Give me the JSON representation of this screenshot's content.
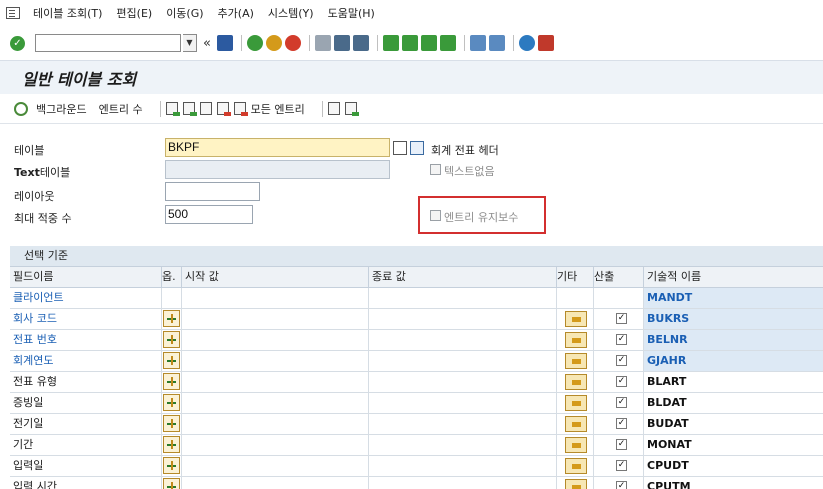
{
  "menubar": {
    "items": [
      "테이블 조회(T)",
      "편집(E)",
      "이동(G)",
      "추가(A)",
      "시스템(Y)",
      "도움말(H)"
    ]
  },
  "toolbar": {
    "command_value": "",
    "nav_symbol": "«",
    "icons": [
      "save-icon",
      "back-icon",
      "exit-icon",
      "cancel-icon",
      "print-icon",
      "find-icon",
      "find-next-icon",
      "first-page-icon",
      "prev-page-icon",
      "next-page-icon",
      "last-page-icon",
      "new-session-icon",
      "shortcut-icon",
      "help-icon",
      "layout-icon"
    ],
    "colors": {
      "ok": "#3a9a3a",
      "exit": "#d49a1a",
      "cancel": "#d23b2b"
    }
  },
  "title": "일반 테이블 조회",
  "app_toolbar": {
    "background_label": "백그라운드",
    "entries_label": "엔트리 수",
    "all_entries_label": "모든 엔트리"
  },
  "form": {
    "table_label": "테이블",
    "table_value": "BKPF",
    "table_desc": "회계 전표 헤더",
    "text_table_label_bold": "Text",
    "text_table_label_rest": "테이블",
    "no_text_label": "텍스트없음",
    "layout_label": "레이아웃",
    "layout_value": "",
    "max_hits_label": "최대 적중 수",
    "max_hits_value": "500",
    "maintain_entries_label": "엔트리 유지보수"
  },
  "table": {
    "section_title": "선택 기준",
    "headers": {
      "name": "필드이름",
      "opt": "옵.",
      "from": "시작 값",
      "to": "종료 값",
      "more": "기타",
      "output": "산출",
      "tech": "기술적 이름"
    },
    "rows": [
      {
        "name": "클라이언트",
        "key": true,
        "opt": false,
        "checked": false,
        "tech": "MANDT"
      },
      {
        "name": "회사 코드",
        "key": true,
        "opt": true,
        "checked": true,
        "tech": "BUKRS"
      },
      {
        "name": "전표 번호",
        "key": true,
        "opt": true,
        "checked": true,
        "tech": "BELNR"
      },
      {
        "name": "회계연도",
        "key": true,
        "opt": true,
        "checked": true,
        "tech": "GJAHR"
      },
      {
        "name": "전표 유형",
        "key": false,
        "opt": true,
        "checked": true,
        "tech": "BLART"
      },
      {
        "name": "증빙일",
        "key": false,
        "opt": true,
        "checked": true,
        "tech": "BLDAT"
      },
      {
        "name": "전기일",
        "key": false,
        "opt": true,
        "checked": true,
        "tech": "BUDAT"
      },
      {
        "name": "기간",
        "key": false,
        "opt": true,
        "checked": true,
        "tech": "MONAT"
      },
      {
        "name": "입력일",
        "key": false,
        "opt": true,
        "checked": true,
        "tech": "CPUDT"
      },
      {
        "name": "입력 시간",
        "key": false,
        "opt": true,
        "checked": true,
        "tech": "CPUTM"
      }
    ],
    "colors": {
      "key_text": "#1a5fb4",
      "key_background": "#dde9f5"
    }
  },
  "highlight_color": "#d32f2f"
}
